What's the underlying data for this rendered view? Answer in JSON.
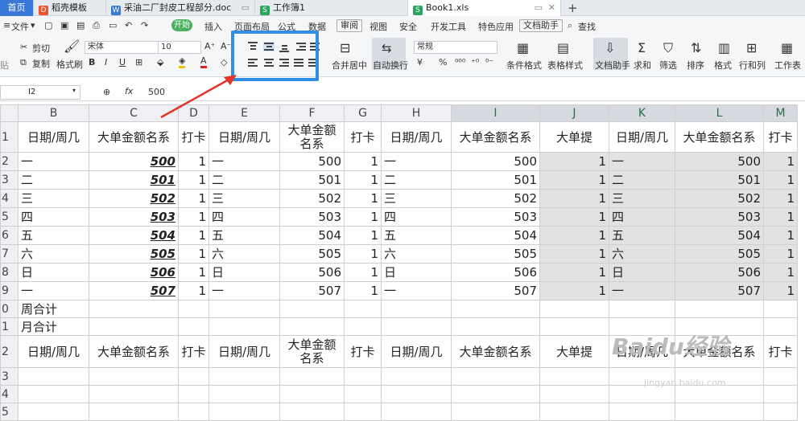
{
  "tabs": [
    {
      "label": "首页",
      "type": "home"
    },
    {
      "label": "稻壳模板",
      "icon": "docer-icon",
      "color": "#e8542c"
    },
    {
      "label": "采油二厂封皮工程部分.doc",
      "icon": "word-icon",
      "color": "#3a78d8"
    },
    {
      "label": "工作簿1",
      "icon": "sheet-icon",
      "color": "#2aa660"
    },
    {
      "label": "Book1.xls",
      "icon": "sheet-icon",
      "color": "#2aa660",
      "active": true
    }
  ],
  "menu": {
    "file": "文件",
    "kaishi": "开始",
    "items": [
      "插入",
      "页面布局",
      "公式",
      "数据",
      "审阅",
      "视图",
      "安全",
      "开发工具",
      "特色应用",
      "文档助手"
    ],
    "search": "查找"
  },
  "ribbon": {
    "cut": "剪切",
    "copy": "复制",
    "format_painter": "格式刷",
    "paste_abbr": "贴",
    "font": "宋体",
    "size": "10",
    "merge": "合并居中",
    "wrap": "自动换行",
    "number_format": "常规",
    "cond": "条件格式",
    "table_style": "表格样式",
    "doc_helper": "文档助手",
    "sum": "求和",
    "filter": "筛选",
    "sort": "排序",
    "format": "格式",
    "rowcol": "行和列",
    "sheet": "工作表"
  },
  "formula": {
    "cell": "I2",
    "fx": "fx",
    "value": "500"
  },
  "columns": [
    "B",
    "C",
    "D",
    "E",
    "F",
    "G",
    "H",
    "I",
    "J",
    "K",
    "L",
    "M"
  ],
  "header_row": [
    "日期/周几",
    "大单金额名系",
    "打卡",
    "日期/周几",
    "大单金额名系",
    "打卡",
    "日期/周几",
    "大单金额名系",
    "大单提",
    "日期/周几",
    "大单金额名系",
    "打卡"
  ],
  "days": [
    "一",
    "二",
    "三",
    "四",
    "五",
    "六",
    "日",
    "一"
  ],
  "amounts": [
    "500",
    "501",
    "502",
    "503",
    "504",
    "505",
    "506",
    "507"
  ],
  "ones": [
    "1",
    "1",
    "1",
    "1",
    "1",
    "1",
    "1",
    "1"
  ],
  "row_nums": [
    "1",
    "2",
    "3",
    "4",
    "5",
    "6",
    "7",
    "8",
    "9",
    "0",
    "1",
    "2",
    "3",
    "4",
    "5"
  ],
  "row10": "周合计",
  "row11": "月合计",
  "watermark": "Baidu经验",
  "watermark_url": "jingyan.baidu.com"
}
